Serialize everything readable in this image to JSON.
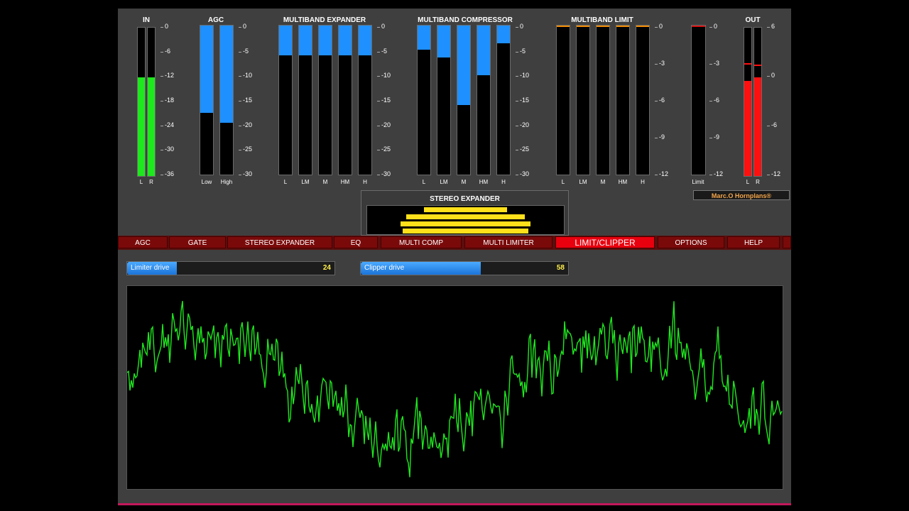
{
  "colors": {
    "in_meter": "#1ee81e",
    "blue_meter": "#1e90ff",
    "out_meter": "#ff1010",
    "limit_peak": "#f08c00",
    "active_tab": "#e8000f",
    "waveform": "#1ee81e"
  },
  "meters": {
    "in": {
      "title": "IN",
      "channels": [
        {
          "label": "L",
          "level_db": -12
        },
        {
          "label": "R",
          "level_db": -12
        }
      ],
      "scale": [
        "0",
        "-6",
        "-12",
        "-18",
        "-24",
        "-30",
        "-36"
      ]
    },
    "agc": {
      "title": "AGC",
      "channels": [
        {
          "label": "Low",
          "gain_reduction_db": -17.5
        },
        {
          "label": "High",
          "gain_reduction_db": -19.5
        }
      ],
      "scale": [
        "0",
        "-5",
        "-10",
        "-15",
        "-20",
        "-25",
        "-30"
      ]
    },
    "expander": {
      "title": "MULTIBAND EXPANDER",
      "channels": [
        {
          "label": "L",
          "gain_reduction_db": -6
        },
        {
          "label": "LM",
          "gain_reduction_db": -6
        },
        {
          "label": "M",
          "gain_reduction_db": -6
        },
        {
          "label": "HM",
          "gain_reduction_db": -6
        },
        {
          "label": "H",
          "gain_reduction_db": -6
        }
      ],
      "scale": [
        "0",
        "-5",
        "-10",
        "-15",
        "-20",
        "-25",
        "-30"
      ]
    },
    "compressor": {
      "title": "MULTIBAND COMPRESSOR",
      "channels": [
        {
          "label": "L",
          "gain_reduction_db": -4.8
        },
        {
          "label": "LM",
          "gain_reduction_db": -6.4
        },
        {
          "label": "M",
          "gain_reduction_db": -16
        },
        {
          "label": "HM",
          "gain_reduction_db": -10
        },
        {
          "label": "H",
          "gain_reduction_db": -3.6
        }
      ],
      "scale": [
        "0",
        "-5",
        "-10",
        "-15",
        "-20",
        "-25",
        "-30"
      ]
    },
    "limit": {
      "title": "MULTIBAND LIMIT",
      "channels": [
        {
          "label": "L",
          "gain_reduction_db": 0
        },
        {
          "label": "LM",
          "gain_reduction_db": 0
        },
        {
          "label": "M",
          "gain_reduction_db": 0
        },
        {
          "label": "HM",
          "gain_reduction_db": 0
        },
        {
          "label": "H",
          "gain_reduction_db": 0
        }
      ],
      "scale": [
        "0",
        "-3",
        "-6",
        "-9",
        "-12"
      ]
    },
    "final_limit": {
      "label": "Limit",
      "gain_reduction_db": 0,
      "scale": [
        "0",
        "-3",
        "-6",
        "-9",
        "-12"
      ]
    },
    "out": {
      "title": "OUT",
      "channels": [
        {
          "label": "L",
          "level_db": -0.5,
          "peak_db": 1.7
        },
        {
          "label": "R",
          "level_db": 0,
          "peak_db": 1.5
        }
      ],
      "scale": [
        "6",
        "0",
        "-6",
        "-12"
      ]
    }
  },
  "logo": "Marc.O Hornplans®",
  "stereo_expander": {
    "title": "STEREO EXPANDER",
    "bar_widths_pct": [
      42,
      60,
      66,
      64
    ]
  },
  "tabs": [
    {
      "label": "AGC"
    },
    {
      "label": "GATE"
    },
    {
      "label": "STEREO EXPANDER"
    },
    {
      "label": "EQ"
    },
    {
      "label": "MULTI COMP"
    },
    {
      "label": "MULTI LIMITER"
    },
    {
      "label": "LIMIT/CLIPPER",
      "active": true
    },
    {
      "label": "OPTIONS"
    },
    {
      "label": "HELP"
    }
  ],
  "controls": {
    "limiter_drive": {
      "label": "Limiter drive",
      "value": "24",
      "fill_pct": 24
    },
    "clipper_drive": {
      "label": "Clipper drive",
      "value": "58",
      "fill_pct": 58
    }
  }
}
